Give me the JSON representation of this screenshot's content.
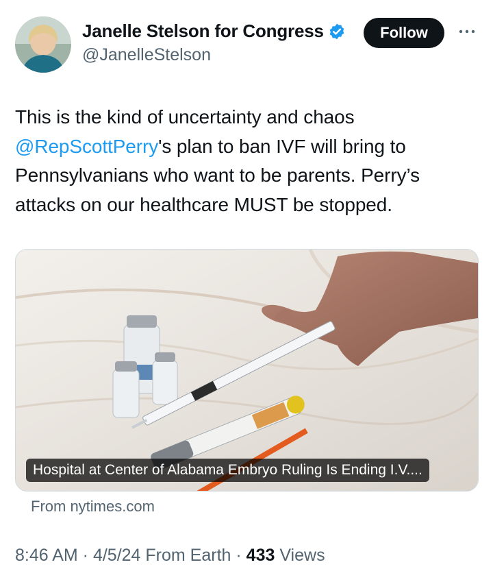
{
  "author": {
    "display_name": "Janelle Stelson for Congress",
    "handle": "@JanelleStelson",
    "verified_icon": "verified-badge-icon"
  },
  "actions": {
    "follow_label": "Follow",
    "more_icon": "more-horizontal-icon"
  },
  "tweet": {
    "text_before": "This is the kind of uncertainty and chaos ",
    "mention": "@RepScottPerry",
    "text_after": "'s plan to ban IVF will bring to Pennsylvanians who want to be parents. Perry’s attacks on our healthcare MUST be stopped."
  },
  "card": {
    "headline": "Hospital at Center of Alabama Embryo Ruling Is Ending I.V....",
    "source": "From nytimes.com"
  },
  "meta": {
    "time": "8:46 AM",
    "separator": " · ",
    "date": "4/5/24",
    "client": " From Earth",
    "views_count": "433",
    "views_label": " Views"
  },
  "colors": {
    "accent": "#1d9bf0",
    "text": "#0f1419",
    "secondary": "#536471"
  }
}
